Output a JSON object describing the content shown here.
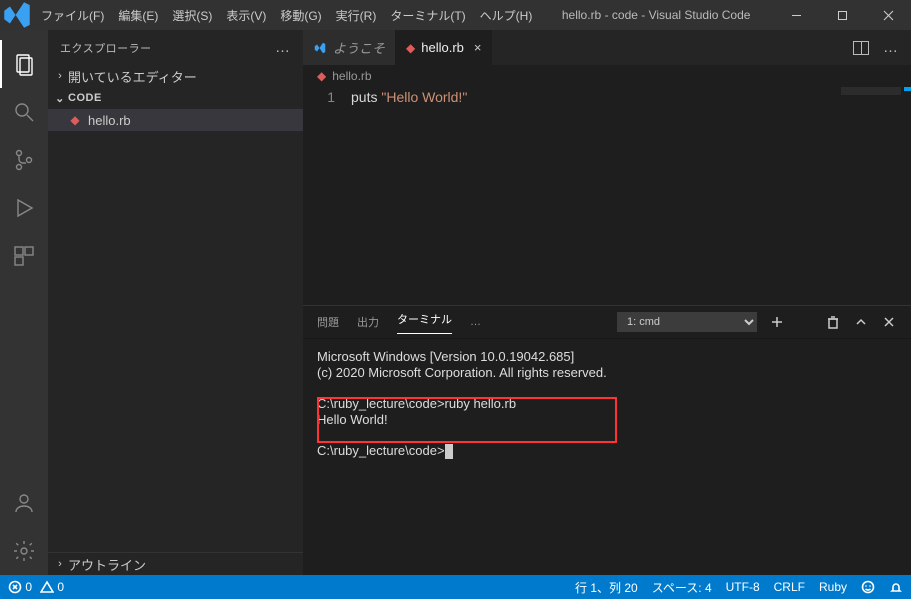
{
  "menu": {
    "items": [
      "ファイル(F)",
      "編集(E)",
      "選択(S)",
      "表示(V)",
      "移動(G)",
      "実行(R)",
      "ターミナル(T)",
      "ヘルプ(H)"
    ]
  },
  "title": "hello.rb - code - Visual Studio Code",
  "explorer": {
    "title": "エクスプローラー",
    "openEditors": "開いているエディター",
    "rootName": "CODE",
    "file": "hello.rb",
    "outline": "アウトライン"
  },
  "tabs": {
    "welcome": "ようこそ",
    "file": "hello.rb"
  },
  "breadcrumb": "hello.rb",
  "code": {
    "lineno": "1",
    "kw": "puts",
    "str": "\"Hello World!\""
  },
  "panel": {
    "problems": "問題",
    "output": "出力",
    "terminal": "ターミナル",
    "dots": "…",
    "termSelect": "1: cmd"
  },
  "terminal": {
    "l1": "Microsoft Windows [Version 10.0.19042.685]",
    "l2": "(c) 2020 Microsoft Corporation. All rights reserved.",
    "l3": "C:\\ruby_lecture\\code>ruby hello.rb",
    "l4": "Hello World!",
    "l5": "C:\\ruby_lecture\\code>"
  },
  "status": {
    "err": "0",
    "warn": "0",
    "pos": "行 1、列 20",
    "spaces": "スペース: 4",
    "enc": "UTF-8",
    "eol": "CRLF",
    "lang": "Ruby"
  }
}
